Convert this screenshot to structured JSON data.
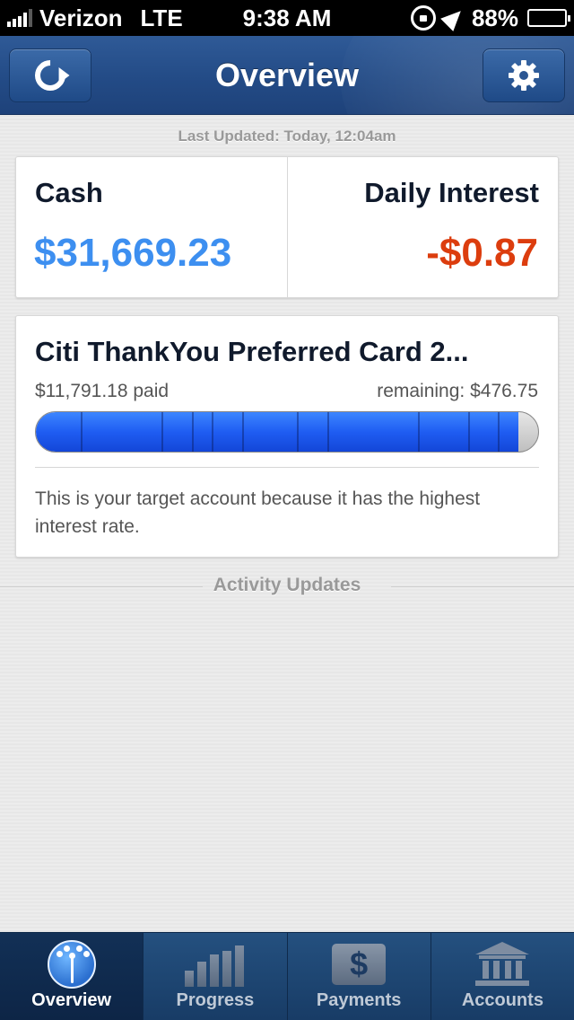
{
  "status_bar": {
    "carrier": "Verizon",
    "network": "LTE",
    "time": "9:38 AM",
    "battery_percent": "88%",
    "battery_level": 0.88,
    "icons": [
      "signal-icon",
      "rotation-lock-icon",
      "location-arrow-icon",
      "battery-icon"
    ]
  },
  "nav": {
    "title": "Overview",
    "left_icon": "refresh-icon",
    "right_icon": "gear-icon"
  },
  "last_updated": "Last Updated: Today, 12:04am",
  "summary": {
    "cash_label": "Cash",
    "cash_value": "$31,669.23",
    "cash_color": "#3d8ff0",
    "interest_label": "Daily Interest",
    "interest_value": "-$0.87",
    "interest_color": "#dc3d0e"
  },
  "target": {
    "account_name": "Citi ThankYou Preferred Card 2...",
    "paid": "$11,791.18 paid",
    "remaining": "remaining: $476.75",
    "progress_fraction": 0.961,
    "segment_fractions": [
      0.09,
      0.25,
      0.31,
      0.35,
      0.41,
      0.52,
      0.58,
      0.76,
      0.86,
      0.92
    ],
    "note": "This is your target account because it has the highest interest rate."
  },
  "activity": {
    "title": "Activity Updates"
  },
  "tabs": [
    {
      "label": "Overview",
      "icon": "dandelion-icon",
      "active": true
    },
    {
      "label": "Progress",
      "icon": "bar-chart-icon",
      "active": false
    },
    {
      "label": "Payments",
      "icon": "dollar-icon",
      "active": false
    },
    {
      "label": "Accounts",
      "icon": "bank-icon",
      "active": false
    }
  ]
}
